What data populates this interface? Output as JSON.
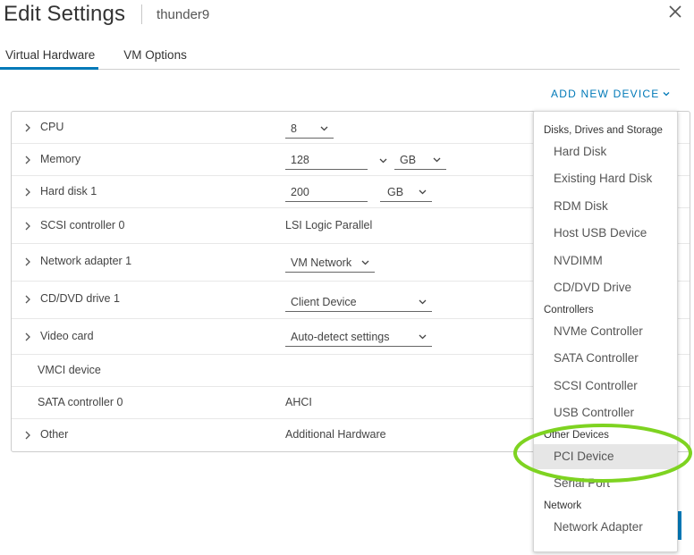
{
  "dialog": {
    "title": "Edit Settings",
    "vm_name": "thunder9",
    "close_icon": "close-icon"
  },
  "tabs": [
    {
      "label": "Virtual Hardware",
      "active": true
    },
    {
      "label": "VM Options",
      "active": false
    }
  ],
  "add_device": {
    "label": "ADD NEW DEVICE"
  },
  "hardware": {
    "cpu": {
      "label": "CPU",
      "value": "8"
    },
    "memory": {
      "label": "Memory",
      "value": "128",
      "unit": "GB"
    },
    "hard_disk": {
      "label": "Hard disk 1",
      "value": "200",
      "unit": "GB"
    },
    "scsi": {
      "label": "SCSI controller 0",
      "value": "LSI Logic Parallel"
    },
    "network": {
      "label": "Network adapter 1",
      "value": "VM Network"
    },
    "cdvd": {
      "label": "CD/DVD drive 1",
      "value": "Client Device"
    },
    "video": {
      "label": "Video card",
      "value": "Auto-detect settings"
    },
    "vmci": {
      "label": "VMCI device"
    },
    "sata": {
      "label": "SATA controller 0",
      "value": "AHCI"
    },
    "other": {
      "label": "Other",
      "value": "Additional Hardware"
    }
  },
  "menu": {
    "disks_header": "Disks, Drives and Storage",
    "hard_disk": "Hard Disk",
    "existing_hard_disk": "Existing Hard Disk",
    "rdm_disk": "RDM Disk",
    "host_usb": "Host USB Device",
    "nvdimm": "NVDIMM",
    "cd_dvd": "CD/DVD Drive",
    "controllers_header": "Controllers",
    "nvme": "NVMe Controller",
    "sata": "SATA Controller",
    "scsi": "SCSI Controller",
    "usb": "USB Controller",
    "other_header": "Other Devices",
    "pci": "PCI Device",
    "serial": "Serial Port",
    "network_header": "Network",
    "network_adapter": "Network Adapter"
  },
  "colors": {
    "accent": "#0079b8",
    "highlight": "#7ed321"
  }
}
